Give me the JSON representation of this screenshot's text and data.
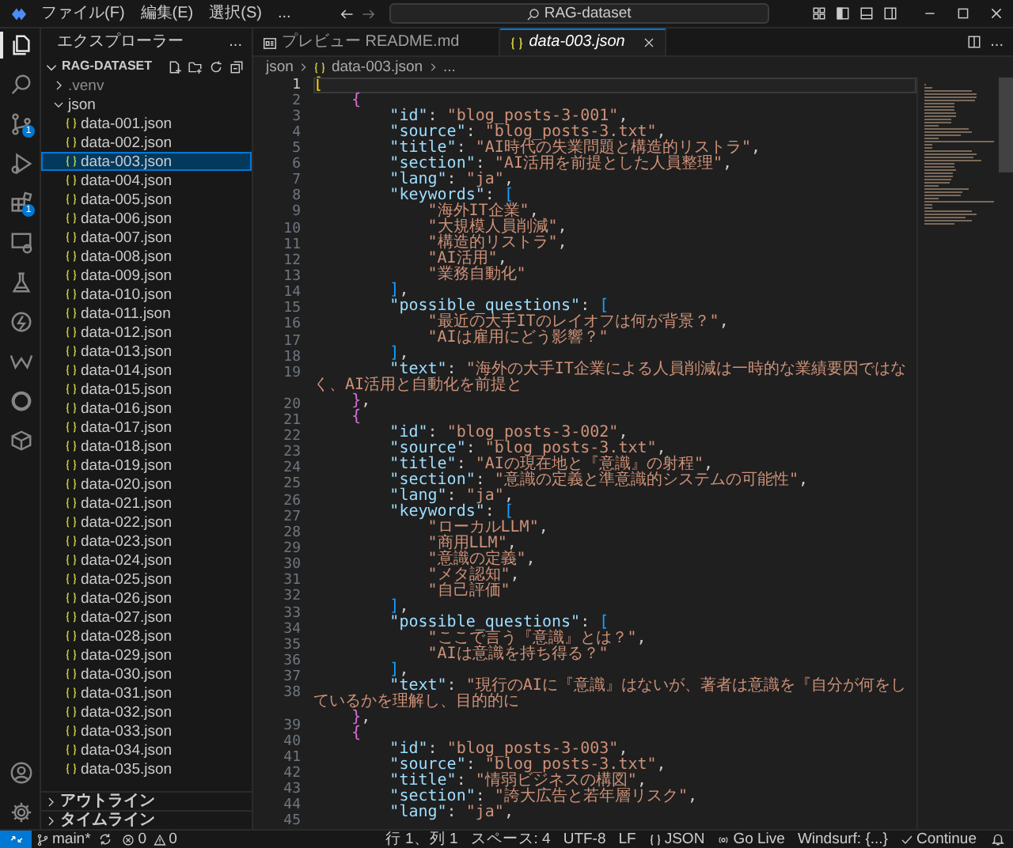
{
  "title_bar": {
    "menus": [
      "ファイル(F)",
      "編集(E)",
      "選択(S)"
    ],
    "more": "...",
    "search": "RAG-dataset"
  },
  "activity_bar": {
    "top": [
      {
        "kind": "explorer",
        "selected": true
      },
      {
        "kind": "search",
        "selected": false
      },
      {
        "kind": "source-control",
        "selected": false,
        "badge": "1"
      },
      {
        "kind": "run-debug",
        "selected": false
      },
      {
        "kind": "extensions",
        "selected": false,
        "badge": "1"
      },
      {
        "kind": "remote",
        "selected": false
      },
      {
        "kind": "testing",
        "selected": false
      },
      {
        "kind": "lightning",
        "selected": false
      },
      {
        "kind": "wave",
        "selected": false
      },
      {
        "kind": "ring",
        "selected": false
      },
      {
        "kind": "box",
        "selected": false
      }
    ],
    "bottom": [
      {
        "kind": "account",
        "selected": false
      },
      {
        "kind": "settings",
        "selected": false
      }
    ]
  },
  "sidebar": {
    "title": "エクスプローラー",
    "more": "...",
    "root": {
      "label": "RAG-DATASET",
      "expanded": true
    },
    "tree": [
      {
        "label": ".venv",
        "expanded": false
      },
      {
        "label": "json",
        "expanded": true,
        "children": [
          {
            "label": "data-001.json",
            "selected": false
          },
          {
            "label": "data-002.json",
            "selected": false
          },
          {
            "label": "data-003.json",
            "selected": true
          },
          {
            "label": "data-004.json",
            "selected": false
          },
          {
            "label": "data-005.json",
            "selected": false
          },
          {
            "label": "data-006.json",
            "selected": false
          },
          {
            "label": "data-007.json",
            "selected": false
          },
          {
            "label": "data-008.json",
            "selected": false
          },
          {
            "label": "data-009.json",
            "selected": false
          },
          {
            "label": "data-010.json",
            "selected": false
          },
          {
            "label": "data-011.json",
            "selected": false
          },
          {
            "label": "data-012.json",
            "selected": false
          },
          {
            "label": "data-013.json",
            "selected": false
          },
          {
            "label": "data-014.json",
            "selected": false
          },
          {
            "label": "data-015.json",
            "selected": false
          },
          {
            "label": "data-016.json",
            "selected": false
          },
          {
            "label": "data-017.json",
            "selected": false
          },
          {
            "label": "data-018.json",
            "selected": false
          },
          {
            "label": "data-019.json",
            "selected": false
          },
          {
            "label": "data-020.json",
            "selected": false
          },
          {
            "label": "data-021.json",
            "selected": false
          },
          {
            "label": "data-022.json",
            "selected": false
          },
          {
            "label": "data-023.json",
            "selected": false
          },
          {
            "label": "data-024.json",
            "selected": false
          },
          {
            "label": "data-025.json",
            "selected": false
          },
          {
            "label": "data-026.json",
            "selected": false
          },
          {
            "label": "data-027.json",
            "selected": false
          },
          {
            "label": "data-028.json",
            "selected": false
          },
          {
            "label": "data-029.json",
            "selected": false
          },
          {
            "label": "data-030.json",
            "selected": false
          },
          {
            "label": "data-031.json",
            "selected": false
          },
          {
            "label": "data-032.json",
            "selected": false
          },
          {
            "label": "data-033.json",
            "selected": false
          },
          {
            "label": "data-034.json",
            "selected": false
          },
          {
            "label": "data-035.json",
            "selected": false
          }
        ]
      }
    ],
    "sections": [
      {
        "label": "アウトライン",
        "expanded": false
      },
      {
        "label": "タイムライン",
        "expanded": false
      }
    ]
  },
  "tabs": [
    {
      "label": "プレビュー README.md",
      "kind": "preview",
      "selected": false,
      "preview_mode": false
    },
    {
      "label": "data-003.json",
      "kind": "json",
      "selected": true,
      "preview_mode": true
    }
  ],
  "editor_actions": {
    "more": "..."
  },
  "breadcrumb": [
    {
      "label": "json",
      "kind": "folder"
    },
    {
      "label": "data-003.json",
      "kind": "json"
    },
    {
      "label": "...",
      "kind": "symbol"
    }
  ],
  "editor": {
    "lines": [
      {
        "number": "1",
        "code": "[",
        "active": true
      },
      {
        "number": "2",
        "code": "    {",
        "active": false
      },
      {
        "number": "3",
        "code": "        \"id\": \"blog_posts-3-001\",",
        "active": false
      },
      {
        "number": "4",
        "code": "        \"source\": \"blog_posts-3.txt\",",
        "active": false
      },
      {
        "number": "5",
        "code": "        \"title\": \"AI時代の失業問題と構造的リストラ\",",
        "active": false
      },
      {
        "number": "6",
        "code": "        \"section\": \"AI活用を前提とした人員整理\",",
        "active": false
      },
      {
        "number": "7",
        "code": "        \"lang\": \"ja\",",
        "active": false
      },
      {
        "number": "8",
        "code": "        \"keywords\": [",
        "active": false
      },
      {
        "number": "9",
        "code": "            \"海外IT企業\",",
        "active": false
      },
      {
        "number": "10",
        "code": "            \"大規模人員削減\",",
        "active": false
      },
      {
        "number": "11",
        "code": "            \"構造的リストラ\",",
        "active": false
      },
      {
        "number": "12",
        "code": "            \"AI活用\",",
        "active": false
      },
      {
        "number": "13",
        "code": "            \"業務自動化\"",
        "active": false
      },
      {
        "number": "14",
        "code": "        ],",
        "active": false
      },
      {
        "number": "15",
        "code": "        \"possible_questions\": [",
        "active": false
      },
      {
        "number": "16",
        "code": "            \"最近の大手ITのレイオフは何が背景？\",",
        "active": false
      },
      {
        "number": "17",
        "code": "            \"AIは雇用にどう影響？\"",
        "active": false
      },
      {
        "number": "18",
        "code": "        ],",
        "active": false
      },
      {
        "number": "19",
        "code": "        \"text\": \"海外の大手IT企業による人員削減は一時的な業績要因ではなく、AI活用と自動化を前提と",
        "active": false
      },
      {
        "number": "20",
        "code": "    },",
        "active": false
      },
      {
        "number": "21",
        "code": "    {",
        "active": false
      },
      {
        "number": "22",
        "code": "        \"id\": \"blog_posts-3-002\",",
        "active": false
      },
      {
        "number": "23",
        "code": "        \"source\": \"blog_posts-3.txt\",",
        "active": false
      },
      {
        "number": "24",
        "code": "        \"title\": \"AIの現在地と『意識』の射程\",",
        "active": false
      },
      {
        "number": "25",
        "code": "        \"section\": \"意識の定義と準意識的システムの可能性\",",
        "active": false
      },
      {
        "number": "26",
        "code": "        \"lang\": \"ja\",",
        "active": false
      },
      {
        "number": "27",
        "code": "        \"keywords\": [",
        "active": false
      },
      {
        "number": "28",
        "code": "            \"ローカルLLM\",",
        "active": false
      },
      {
        "number": "29",
        "code": "            \"商用LLM\",",
        "active": false
      },
      {
        "number": "30",
        "code": "            \"意識の定義\",",
        "active": false
      },
      {
        "number": "31",
        "code": "            \"メタ認知\",",
        "active": false
      },
      {
        "number": "32",
        "code": "            \"自己評価\"",
        "active": false
      },
      {
        "number": "33",
        "code": "        ],",
        "active": false
      },
      {
        "number": "34",
        "code": "        \"possible_questions\": [",
        "active": false
      },
      {
        "number": "35",
        "code": "            \"ここで言う『意識』とは？\",",
        "active": false
      },
      {
        "number": "36",
        "code": "            \"AIは意識を持ち得る？\"",
        "active": false
      },
      {
        "number": "37",
        "code": "        ],",
        "active": false
      },
      {
        "number": "38",
        "code": "        \"text\": \"現行のAIに『意識』はないが、著者は意識を『自分が何をしているかを理解し、目的的に",
        "active": false
      },
      {
        "number": "39",
        "code": "    },",
        "active": false
      },
      {
        "number": "40",
        "code": "    {",
        "active": false
      },
      {
        "number": "41",
        "code": "        \"id\": \"blog_posts-3-003\",",
        "active": false
      },
      {
        "number": "42",
        "code": "        \"source\": \"blog_posts-3.txt\",",
        "active": false
      },
      {
        "number": "43",
        "code": "        \"title\": \"情弱ビジネスの構図\",",
        "active": false
      },
      {
        "number": "44",
        "code": "        \"section\": \"誇大広告と若年層リスク\",",
        "active": false
      },
      {
        "number": "45",
        "code": "        \"lang\": \"ja\",",
        "active": false
      }
    ]
  },
  "status_bar": {
    "left": [
      {
        "kind": "remote"
      },
      {
        "kind": "branch",
        "label": "main*"
      },
      {
        "kind": "sync"
      },
      {
        "kind": "problems",
        "errors": "0",
        "warnings": "0"
      }
    ],
    "right": [
      {
        "kind": "text",
        "label": "行 1、列 1"
      },
      {
        "kind": "text",
        "label": "スペース: 4"
      },
      {
        "kind": "text",
        "label": "UTF-8"
      },
      {
        "kind": "text",
        "label": "LF"
      },
      {
        "kind": "language",
        "label": "JSON"
      },
      {
        "kind": "golive",
        "label": "Go Live"
      },
      {
        "kind": "text",
        "label": "Windsurf: {...}"
      },
      {
        "kind": "check",
        "label": "Continue"
      },
      {
        "kind": "bell"
      }
    ]
  }
}
